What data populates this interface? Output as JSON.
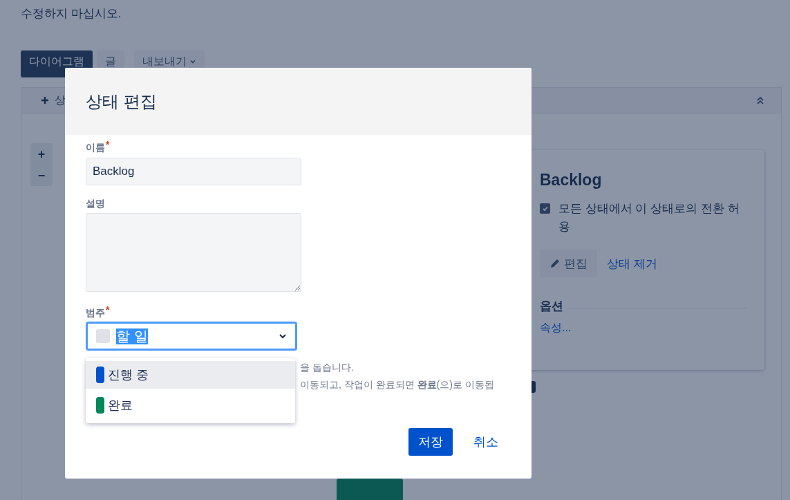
{
  "page": {
    "description": "수정하지 마십시오.",
    "tabs": [
      {
        "label": "다이어그램",
        "selected": true
      },
      {
        "label": "글",
        "selected": false
      }
    ],
    "export_button": "내보내기",
    "toolbar_button": "상",
    "zoom_in": "+",
    "zoom_out": "−"
  },
  "status_panel": {
    "title": "Backlog",
    "allow_all": {
      "label": "모든 상태에서 이 상태로의 전환 허용",
      "checked": true
    },
    "edit_button": "편집",
    "remove_link": "상태 제거",
    "options_heading": "옵션",
    "properties_link": "속성..."
  },
  "dialog": {
    "title": "상태 편집",
    "name_label": "이름",
    "name_required": "*",
    "name_value": "Backlog",
    "description_label": "설명",
    "category_label": "범주",
    "category_required": "*",
    "category_value": "할 일",
    "options": [
      {
        "label": "진행 중",
        "color": "#0052cc",
        "selected": true
      },
      {
        "label": "완료",
        "color": "#00875a",
        "selected": false
      }
    ],
    "help_lines": [
      "을 돕습니다.",
      "이동되고, 작업이 완료되면 **완료**(으)로 이동됩"
    ],
    "save_button": "저장",
    "cancel_link": "취소"
  }
}
